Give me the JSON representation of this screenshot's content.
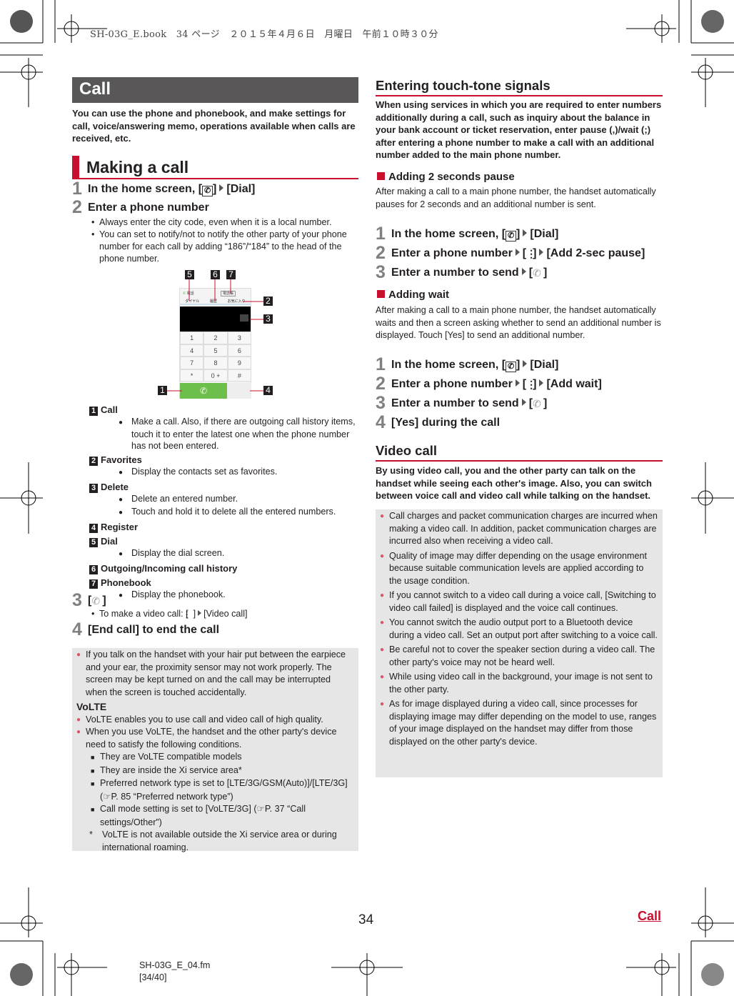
{
  "print_header": "SH-03G_E.book　34 ページ　２０１５年４月６日　月曜日　午前１０時３０分",
  "left": {
    "chapter": "Call",
    "intro": "You can use the phone and phonebook, and make settings for call, voice/answering memo, operations available when calls are received, etc.",
    "section": "Making a call",
    "step1": {
      "num": "1",
      "parts": [
        "In the home screen, [",
        {
          "icon": "phone-app"
        },
        "]",
        {
          "icon": "arrow"
        },
        "[Dial]"
      ]
    },
    "step2": {
      "num": "2",
      "parts": [
        "Enter a phone number"
      ]
    },
    "step2_bullets": [
      "Always enter the city code, even when it is a local number.",
      "You can set to notify/not to notify the other party of your phone number for each call by adding “186”/“184” to the head of the phone number."
    ],
    "screen": {
      "tab_phone": "電話",
      "tab_phonebook": "電話帳",
      "tab_dial": "ダイヤル",
      "tab_history": "履歴",
      "tab_favorites": "お気に入り",
      "keys": [
        "1",
        "2",
        "3",
        "4",
        "5",
        "6",
        "7",
        "8",
        "9",
        "*",
        "0 +",
        "#"
      ],
      "callouts": [
        "5",
        "6",
        "7",
        "2",
        "3",
        "1",
        "4"
      ]
    },
    "legend": [
      {
        "num": "1",
        "title": "Call",
        "desc": [
          "Make a call. Also, if there are outgoing call history items, touch it to enter the latest one when the phone number has not been entered."
        ]
      },
      {
        "num": "2",
        "title": "Favorites",
        "desc": [
          "Display the contacts set as favorites."
        ]
      },
      {
        "num": "3",
        "title": "Delete",
        "desc": [
          "Delete an entered number.",
          "Touch and hold it to delete all the entered numbers."
        ]
      },
      {
        "num": "4",
        "title": "Register",
        "desc": []
      },
      {
        "num": "5",
        "title": "Dial",
        "desc": [
          "Display the dial screen."
        ]
      },
      {
        "num": "6",
        "title": "Outgoing/Incoming call history",
        "desc": []
      },
      {
        "num": "7",
        "title": "Phonebook",
        "desc": [
          "Display the phonebook."
        ]
      }
    ],
    "step3": {
      "num": "3",
      "parts": [
        "[",
        {
          "icon": "call"
        },
        "]"
      ]
    },
    "step3_bullet": {
      "parts": [
        "To make a video call: [",
        {
          "icon": "menu"
        },
        "]",
        {
          "icon": "arrow"
        },
        "[Video call]"
      ]
    },
    "step4": {
      "num": "4",
      "parts": [
        "[End call] to end the call"
      ]
    },
    "note": {
      "p1": "If you talk on the handset with your hair put between the earpiece and your ear, the proximity sensor may not work properly. The screen may be kept turned on and the call may be interrupted when the screen is touched accidentally.",
      "volte_heading": "VoLTE",
      "p2": "VoLTE enables you to use call and video call of high quality.",
      "p3": "When you use VoLTE, the handset and the other party's device need to satisfy the following conditions.",
      "conditions": [
        "They are VoLTE compatible models",
        "They are inside the Xi service area*",
        "Preferred network type is set to [LTE/3G/GSM(Auto)]/[LTE/3G] (☞P. 85 “Preferred network type”)",
        "Call mode setting is set to [VoLTE/3G] (☞P. 37 “Call settings/Other”)"
      ],
      "footnote_mark": "*",
      "footnote": "VoLTE is not available outside the Xi service area or during international roaming."
    }
  },
  "right": {
    "heading": "Entering touch-tone signals",
    "intro": "When using services in which you are required to enter numbers additionally during a call, such as inquiry about the balance in your bank account or ticket reservation, enter pause (,)/wait (;) after entering a phone number to make a call with an additional number added to the main phone number.",
    "pause": {
      "title": "Adding 2 seconds pause",
      "desc": "After making a call to a main phone number, the handset automatically pauses for 2 seconds and an additional number is sent.",
      "steps": [
        {
          "num": "1",
          "parts": [
            "In the home screen, [",
            {
              "icon": "phone-app"
            },
            "]",
            {
              "icon": "arrow"
            },
            "[Dial]"
          ]
        },
        {
          "num": "2",
          "parts": [
            "Enter a phone number",
            {
              "icon": "arrow"
            },
            "[",
            {
              "icon": "menu"
            },
            "]",
            {
              "icon": "arrow"
            },
            "[Add 2-sec pause]"
          ]
        },
        {
          "num": "3",
          "parts": [
            "Enter a number to send",
            {
              "icon": "arrow"
            },
            "[",
            {
              "icon": "call"
            },
            "]"
          ]
        }
      ]
    },
    "wait": {
      "title": "Adding wait",
      "desc": "After making a call to a main phone number, the handset automatically waits and then a screen asking whether to send an additional number is displayed. Touch [Yes] to send an additional number.",
      "steps": [
        {
          "num": "1",
          "parts": [
            "In the home screen, [",
            {
              "icon": "phone-app"
            },
            "]",
            {
              "icon": "arrow"
            },
            "[Dial]"
          ]
        },
        {
          "num": "2",
          "parts": [
            "Enter a phone number",
            {
              "icon": "arrow"
            },
            "[",
            {
              "icon": "menu"
            },
            "]",
            {
              "icon": "arrow"
            },
            "[Add wait]"
          ]
        },
        {
          "num": "3",
          "parts": [
            "Enter a number to send",
            {
              "icon": "arrow"
            },
            "[",
            {
              "icon": "call"
            },
            "]"
          ]
        },
        {
          "num": "4",
          "parts": [
            "[Yes] during the call"
          ]
        }
      ]
    },
    "video_heading": "Video call",
    "video_intro": "By using video call, you and the other party can talk on the handset while seeing each other's image. Also, you can switch between voice call and video call while talking on the handset.",
    "video_notes": [
      "Call charges and packet communication charges are incurred when making a video call. In addition, packet communication charges are incurred also when receiving a video call.",
      "Quality of image may differ depending on the usage environment because suitable communication levels are applied according to the usage condition.",
      "If you cannot switch to a video call during a voice call, [Switching to video call failed] is displayed and the voice call continues.",
      "You cannot switch the audio output port to a Bluetooth device during a video call. Set an output port after switching to a voice call.",
      "Be careful not to cover the speaker section during a video call. The other party's voice may not be heard well.",
      "While using video call in the background, your image is not sent to the other party.",
      "As for image displayed during a video call, since processes for displaying image may differ depending on the model to use, ranges of your image displayed on the handset may differ from those displayed on the other party's device."
    ]
  },
  "footer": {
    "page": "34",
    "section_link": "Call",
    "file": "SH-03G_E_04.fm",
    "pages": "[34/40]"
  },
  "colors": {
    "accent": "#c8102e",
    "chapter_bar": "#595757",
    "note_bg": "#e6e6e6",
    "note_bullet": "#d9546b"
  }
}
